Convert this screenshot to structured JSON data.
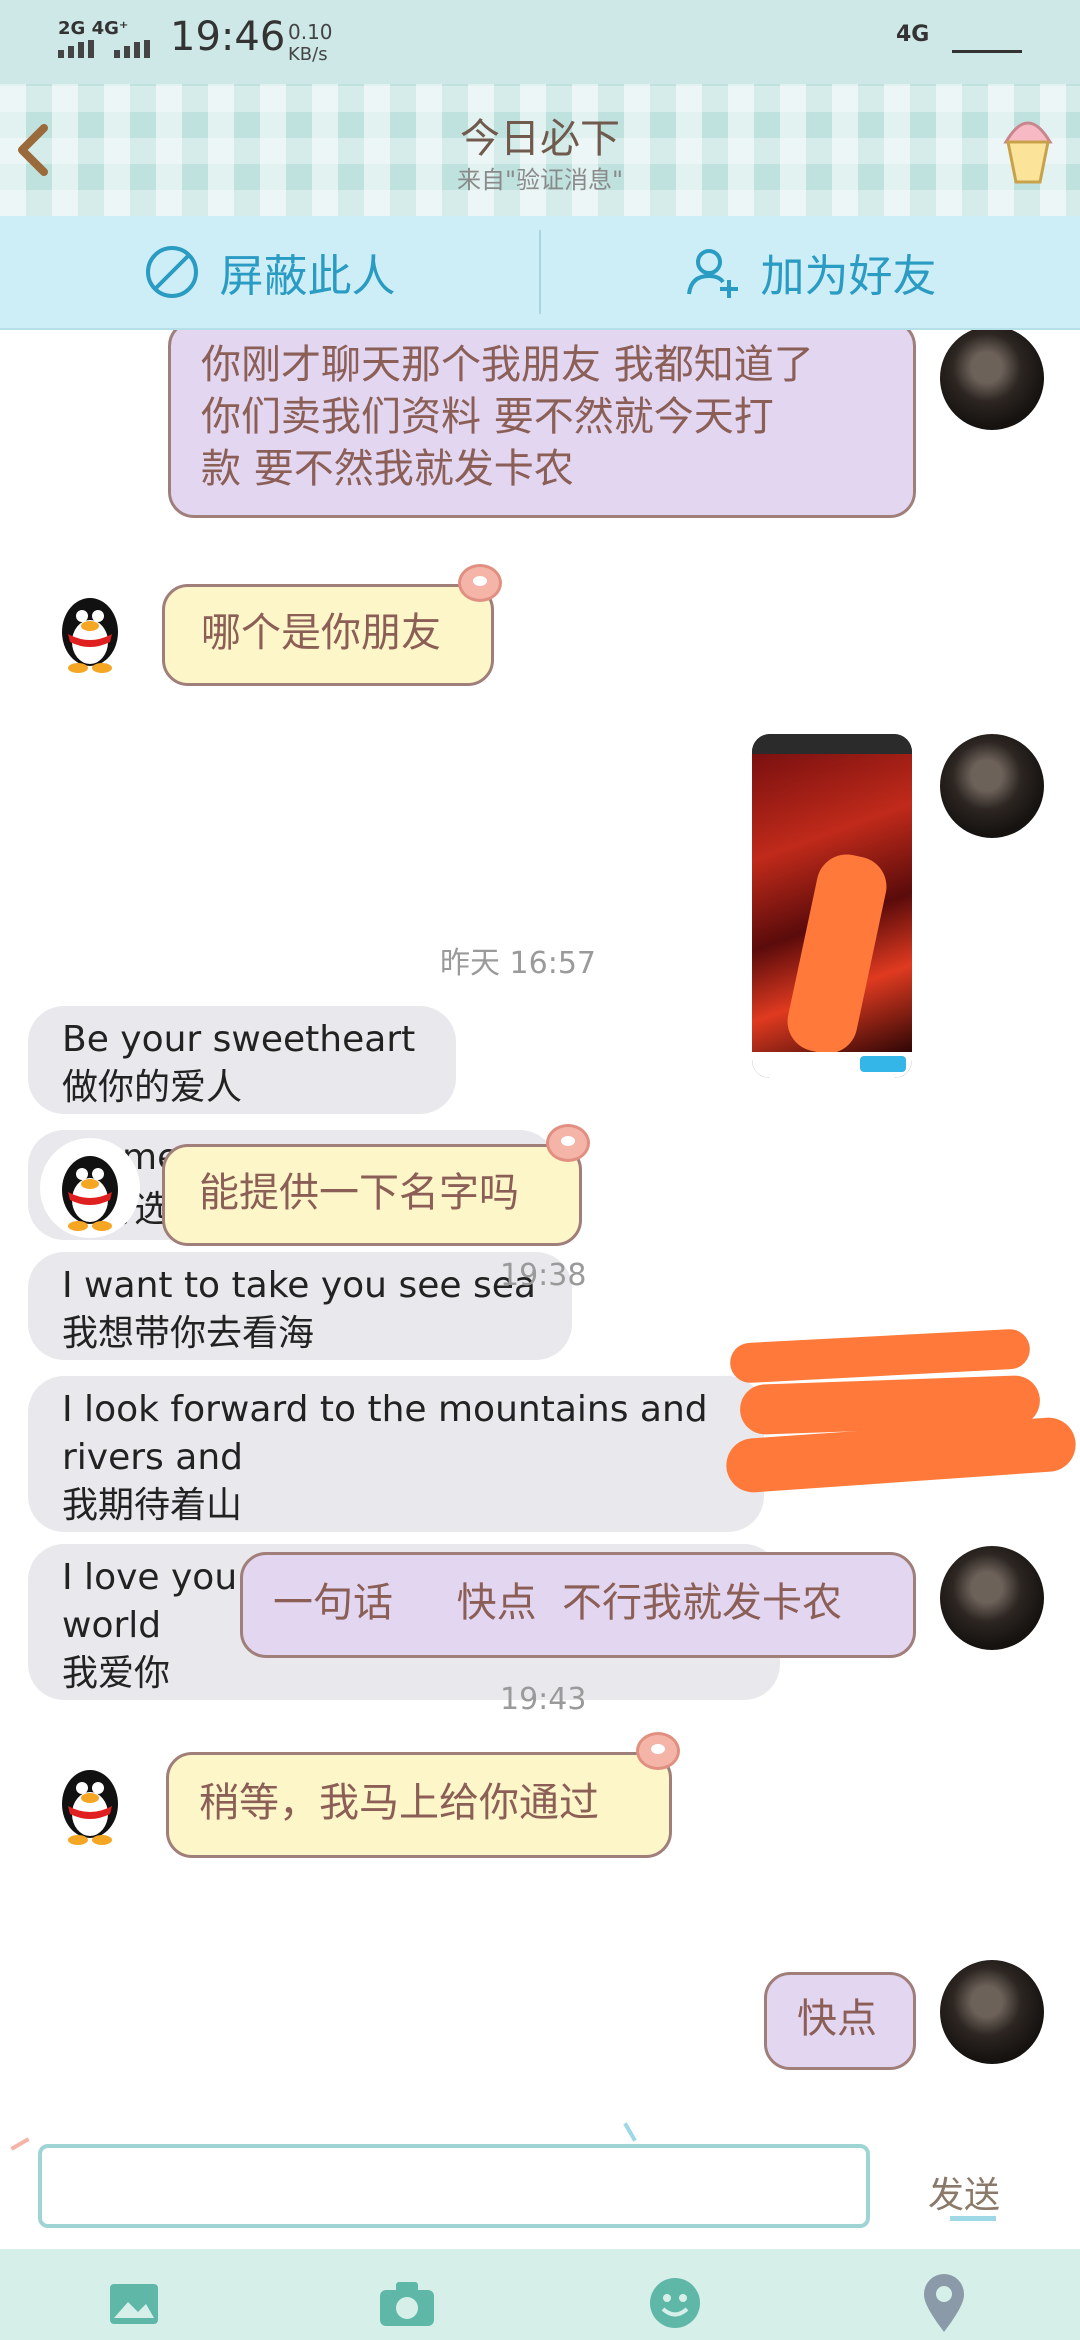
{
  "status_bar": {
    "network_left": "2G 4G⁺",
    "time": "19:46",
    "speed_value": "0.10",
    "speed_unit": "KB/s",
    "network_right": "4G"
  },
  "header": {
    "title": "今日必下",
    "subtitle": "来自\"验证消息\"",
    "back_icon": "chevron-left-icon",
    "profile_icon": "ice-cream-icon"
  },
  "actions": {
    "block": "屏蔽此人",
    "add_friend": "加为好友"
  },
  "messages": {
    "m1": [
      "你刚才聊天那个我朋友  我都知道了",
      "你们卖我们资料   要不然就今天打",
      "款  要不然我就发卡农"
    ],
    "m2": "哪个是你朋友",
    "m3": "能提供一下名字吗",
    "m4": "一句话     快点  不行我就发卡农",
    "m5": "稍等，我马上给你通过",
    "m6": "快点"
  },
  "timestamps": {
    "t1": "昨天 16:57",
    "t2": "19:38",
    "t3": "19:43"
  },
  "screenshot_overlay": {
    "lines": [
      [
        "Be your sweetheart",
        "做你的爱人"
      ],
      [
        "me",
        "记得选我"
      ],
      [
        "I want to take you see sea",
        "我想带你去看海"
      ],
      [
        "I look forward to the mountains and",
        "rivers and",
        "我期待着山"
      ],
      [
        "I love you  more  than  anyone in  the",
        "world",
        "我爱你"
      ]
    ]
  },
  "input": {
    "placeholder": "",
    "send": "发送"
  },
  "toolbar_icons": [
    "image-icon",
    "camera-icon",
    "emoji-icon",
    "location-icon"
  ],
  "colors": {
    "accent_blue": "#2a9bc2",
    "bubble_purple": "#e2d6f0",
    "bubble_yellow": "#fdf6c9",
    "bubble_border": "#a07e7a",
    "bubble_text": "#8b5e56"
  }
}
